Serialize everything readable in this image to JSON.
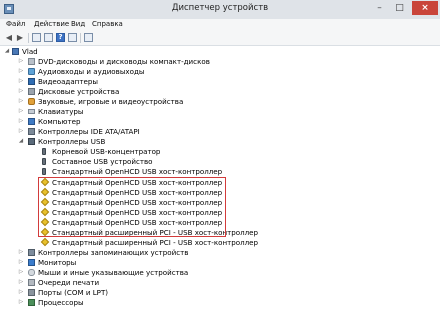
{
  "window": {
    "title": "Диспетчер устройств",
    "controls": {
      "minimize": "–",
      "maximize": "□",
      "close": "×"
    }
  },
  "menu": {
    "items": [
      "Файл",
      "Действие",
      "Вид",
      "Справка"
    ]
  },
  "toolbar": {
    "buttons": [
      "back-icon",
      "forward-icon",
      "properties-icon",
      "list-icon",
      "help-icon",
      "scan-icon"
    ],
    "help_label": "?"
  },
  "tree": {
    "root": "Vlad",
    "items": [
      {
        "label": "DVD-дисководы и дисководы компакт-дисков",
        "icon": "drive-icon"
      },
      {
        "label": "Аудиовходы и аудиовыходы",
        "icon": "audio-icon"
      },
      {
        "label": "Видеоадаптеры",
        "icon": "display-adapter-icon"
      },
      {
        "label": "Дисковые устройства",
        "icon": "disk-icon"
      },
      {
        "label": "Звуковые, игровые и видеоустройства",
        "icon": "sound-icon"
      },
      {
        "label": "Клавиатуры",
        "icon": "keyboard-icon"
      },
      {
        "label": "Компьютер",
        "icon": "computer-icon"
      },
      {
        "label": "Контроллеры IDE ATA/ATAPI",
        "icon": "ide-icon"
      },
      {
        "label": "Контроллеры USB",
        "icon": "usb-icon"
      }
    ],
    "usb_children": [
      {
        "label": "Корневой USB-концентратор",
        "icon": "usb-device-icon"
      },
      {
        "label": "Составное USB устройство",
        "icon": "usb-device-icon"
      },
      {
        "label": "Стандартный OpenHCD USB хост-контроллер",
        "icon": "usb-device-icon"
      },
      {
        "label": "Стандартный OpenHCD USB хост-контроллер",
        "icon": "warning-icon"
      },
      {
        "label": "Стандартный OpenHCD USB хост-контроллер",
        "icon": "warning-icon"
      },
      {
        "label": "Стандартный OpenHCD USB хост-контроллер",
        "icon": "warning-icon"
      },
      {
        "label": "Стандартный OpenHCD USB хост-контроллер",
        "icon": "warning-icon"
      },
      {
        "label": "Стандартный OpenHCD USB хост-контроллер",
        "icon": "warning-icon"
      },
      {
        "label": "Стандартный расширенный PCI - USB хост-контроллер",
        "icon": "warning-icon"
      },
      {
        "label": "Стандартный расширенный PCI - USB хост-контроллер",
        "icon": "warning-icon"
      }
    ],
    "after_items": [
      {
        "label": "Контроллеры запоминающих устройств",
        "icon": "storage-icon"
      },
      {
        "label": "Мониторы",
        "icon": "monitor-icon"
      },
      {
        "label": "Мыши и иные указывающие устройства",
        "icon": "mouse-icon"
      },
      {
        "label": "Очереди печати",
        "icon": "print-queue-icon"
      },
      {
        "label": "Порты (COM и LPT)",
        "icon": "port-icon"
      },
      {
        "label": "Процессоры",
        "icon": "cpu-icon"
      }
    ]
  },
  "colors": {
    "highlight_border": "#d23b3b",
    "close_button": "#c9453a"
  }
}
